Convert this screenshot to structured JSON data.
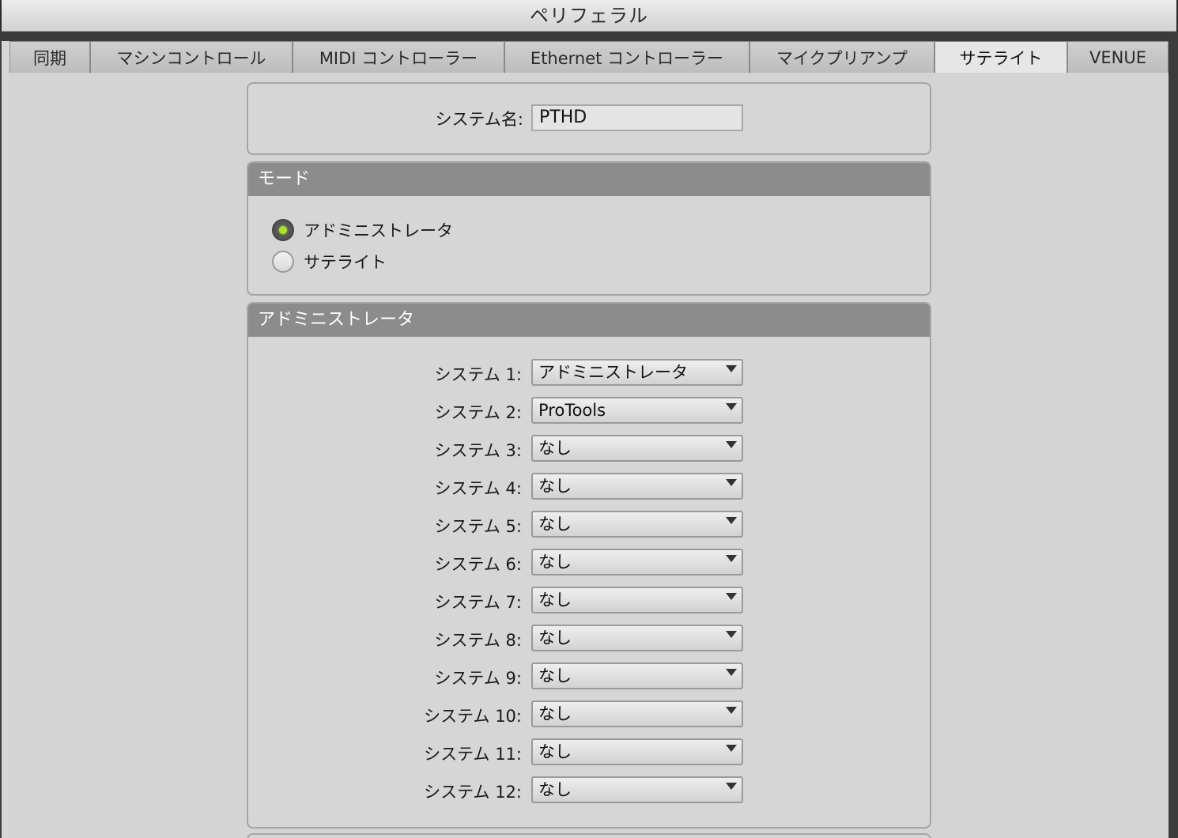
{
  "window": {
    "title": "ペリフェラル"
  },
  "tabs": [
    {
      "label": "同期"
    },
    {
      "label": "マシンコントロール"
    },
    {
      "label": "MIDI コントローラー"
    },
    {
      "label": "Ethernet コントローラー"
    },
    {
      "label": "マイクプリアンプ"
    },
    {
      "label": "サテライト",
      "active": true
    },
    {
      "label": "VENUE"
    }
  ],
  "system_name": {
    "label": "システム名:",
    "value": "PTHD"
  },
  "mode": {
    "header": "モード",
    "options": [
      {
        "label": "アドミニストレータ",
        "selected": true
      },
      {
        "label": "サテライト",
        "selected": false
      }
    ]
  },
  "admin": {
    "header": "アドミニストレータ",
    "systems": [
      {
        "label": "システム 1:",
        "value": "アドミニストレータ"
      },
      {
        "label": "システム 2:",
        "value": "ProTools"
      },
      {
        "label": "システム 3:",
        "value": "なし"
      },
      {
        "label": "システム 4:",
        "value": "なし"
      },
      {
        "label": "システム 5:",
        "value": "なし"
      },
      {
        "label": "システム 6:",
        "value": "なし"
      },
      {
        "label": "システム 7:",
        "value": "なし"
      },
      {
        "label": "システム 8:",
        "value": "なし"
      },
      {
        "label": "システム 9:",
        "value": "なし"
      },
      {
        "label": "システム 10:",
        "value": "なし"
      },
      {
        "label": "システム 11:",
        "value": "なし"
      },
      {
        "label": "システム 12:",
        "value": "なし"
      }
    ]
  },
  "colors": {
    "radio_on": "#a6e22e",
    "header_bg": "#8c8c8c"
  }
}
